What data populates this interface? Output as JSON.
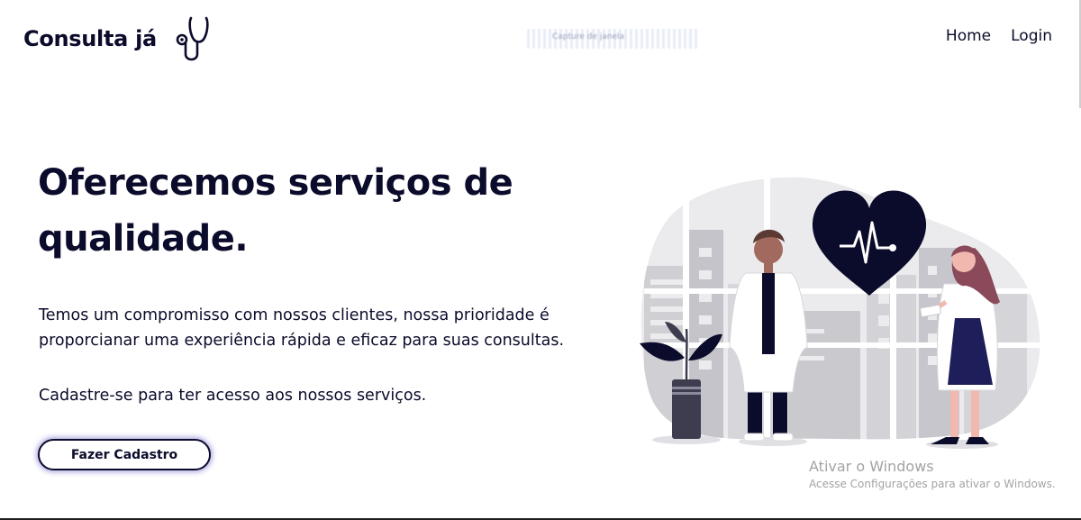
{
  "header": {
    "brand": "Consulta já",
    "brand_icon": "stethoscope-icon",
    "capture_hint": "Capture de janela",
    "nav": [
      {
        "label": "Home"
      },
      {
        "label": "Login"
      }
    ]
  },
  "hero": {
    "title": "Oferecemos serviços de qualidade.",
    "description": "Temos um compromisso com nossos clientes, nossa prioridade é proporcianar uma experiência rápida e eficaz para suas consultas.",
    "cta_text": "Cadastre-se para ter acesso aos nossos serviços.",
    "cta_button": "Fazer Cadastro",
    "illustration": "doctors-heart-illustration"
  },
  "watermark": {
    "title": "Ativar o Windows",
    "subtitle": "Acesse Configurações para ativar o Windows."
  },
  "colors": {
    "primary": "#0b0b2b",
    "background": "#ffffff",
    "illustration_gray": "#d9d9dd",
    "watermark": "#a3a3a3"
  }
}
